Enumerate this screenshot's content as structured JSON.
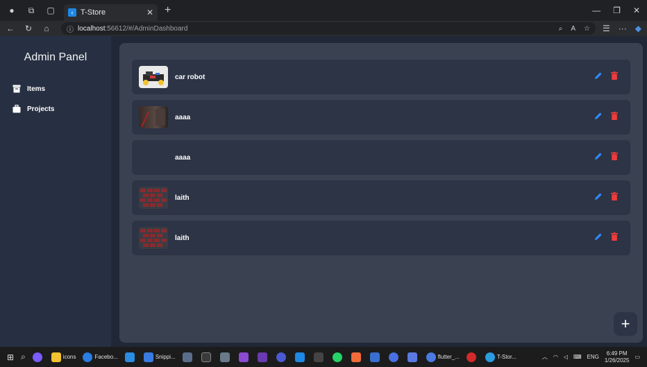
{
  "browser": {
    "tab_title": "T-Store",
    "url_host": "localhost",
    "url_rest": ":56612/#/AdminDashboard"
  },
  "sidebar": {
    "title": "Admin Panel",
    "items": [
      {
        "label": "Items",
        "icon": "archive-icon"
      },
      {
        "label": "Projects",
        "icon": "briefcase-icon"
      }
    ]
  },
  "items": [
    {
      "name": "car robot",
      "thumb": "robot-car"
    },
    {
      "name": "aaaa",
      "thumb": "dark-photo"
    },
    {
      "name": "aaaa",
      "thumb": "none"
    },
    {
      "name": "laith",
      "thumb": "red-texture"
    },
    {
      "name": "laith",
      "thumb": "red-texture"
    }
  ],
  "fab": {
    "label": "+"
  },
  "colors": {
    "accent_edit": "#2f8cff",
    "accent_delete": "#f03b3b",
    "sidebar_bg": "#273042",
    "panel_bg": "#3a4252",
    "row_bg": "#2c3445"
  },
  "taskbar": {
    "apps": [
      "icons",
      "Facebo...",
      "Snippi...",
      "flutter_...",
      "T-Stor..."
    ],
    "lang": "ENG",
    "time": "6:49 PM",
    "date": "1/26/2025"
  }
}
